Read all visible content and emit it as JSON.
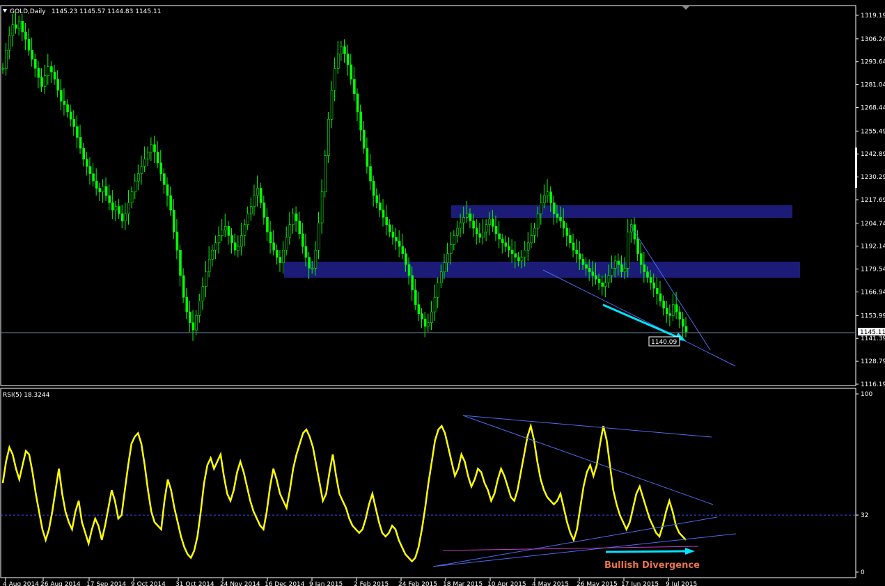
{
  "window": {
    "symbol_label": "GOLD,Daily",
    "ohlc_label": "1145.23 1145.57 1144.83 1145.11",
    "menu_icon": "triangle-down-icon"
  },
  "colors": {
    "background": "#000000",
    "candle": "#00ff00",
    "rsi_line": "#ffff00",
    "zone": "#1c1c78",
    "trendline": "#4c6cf0",
    "arrow": "#00e5ff",
    "magenta_line": "#c040c0",
    "annotation_text": "#e8734a",
    "bid_line": "#6a8aa0"
  },
  "chart_data": [
    {
      "type": "candlestick",
      "title": "GOLD,Daily",
      "ylim": [
        1116.19,
        1319.19
      ],
      "y_ticks": [
        "1319.19",
        "1306.24",
        "1293.64",
        "1281.04",
        "1268.44",
        "1255.49",
        "1242.89",
        "1230.29",
        "1217.69",
        "1204.74",
        "1192.14",
        "1179.54",
        "1166.94",
        "1153.99",
        "1141.39",
        "1128.79",
        "1116.19"
      ],
      "x_ticks": [
        "4 Aug 2014",
        "26 Aug 2014",
        "17 Sep 2014",
        "9 Oct 2014",
        "31 Oct 2014",
        "24 Nov 2014",
        "16 Dec 2014",
        "9 Jan 2015",
        "2 Feb 2015",
        "24 Feb 2015",
        "18 Mar 2015",
        "10 Apr 2015",
        "4 May 2015",
        "26 May 2015",
        "17 Jun 2015",
        "9 Jul 2015"
      ],
      "current_price_label": "1145.11",
      "current_price": 1145.11,
      "annotation_label": "1140.09",
      "closes": [
        1290,
        1300,
        1308,
        1314,
        1312,
        1316,
        1310,
        1306,
        1300,
        1295,
        1290,
        1285,
        1280,
        1286,
        1291,
        1288,
        1284,
        1278,
        1272,
        1270,
        1266,
        1262,
        1258,
        1252,
        1246,
        1240,
        1236,
        1232,
        1228,
        1224,
        1222,
        1225,
        1220,
        1216,
        1212,
        1214,
        1210,
        1206,
        1210,
        1216,
        1222,
        1228,
        1232,
        1236,
        1240,
        1244,
        1248,
        1244,
        1238,
        1232,
        1226,
        1220,
        1212,
        1200,
        1190,
        1176,
        1164,
        1156,
        1150,
        1146,
        1154,
        1162,
        1170,
        1178,
        1185,
        1190,
        1194,
        1198,
        1201,
        1203,
        1198,
        1194,
        1190,
        1192,
        1198,
        1204,
        1210,
        1214,
        1220,
        1224,
        1216,
        1208,
        1200,
        1194,
        1190,
        1186,
        1183,
        1190,
        1197,
        1204,
        1210,
        1206,
        1199,
        1192,
        1186,
        1180,
        1180,
        1190,
        1205,
        1222,
        1242,
        1262,
        1278,
        1290,
        1298,
        1302,
        1298,
        1292,
        1284,
        1276,
        1266,
        1256,
        1246,
        1236,
        1228,
        1220,
        1216,
        1212,
        1208,
        1204,
        1200,
        1197,
        1195,
        1192,
        1188,
        1182,
        1176,
        1168,
        1160,
        1155,
        1152,
        1148,
        1150,
        1156,
        1164,
        1172,
        1178,
        1183,
        1188,
        1193,
        1198,
        1202,
        1205,
        1208,
        1210,
        1206,
        1202,
        1199,
        1197,
        1200,
        1204,
        1207,
        1203,
        1199,
        1196,
        1194,
        1192,
        1190,
        1188,
        1186,
        1184,
        1186,
        1190,
        1194,
        1198,
        1202,
        1210,
        1216,
        1220,
        1222,
        1216,
        1210,
        1208,
        1206,
        1202,
        1198,
        1194,
        1190,
        1188,
        1185,
        1182,
        1180,
        1178,
        1176,
        1174,
        1172,
        1170,
        1172,
        1176,
        1180,
        1184,
        1182,
        1178,
        1180,
        1200,
        1204,
        1196,
        1188,
        1182,
        1178,
        1175,
        1172,
        1169,
        1166,
        1162,
        1158,
        1155,
        1154,
        1160,
        1156,
        1152,
        1148,
        1145
      ],
      "rsi_line": true
    },
    {
      "type": "line",
      "title": "RSI(5) 18.3244",
      "ylim": [
        0,
        100
      ],
      "y_ticks": [
        "100",
        "32",
        "0"
      ],
      "level": 32,
      "annotation": "Bullish Divergence",
      "values": [
        50,
        62,
        70,
        66,
        58,
        52,
        60,
        68,
        66,
        56,
        44,
        34,
        24,
        18,
        24,
        34,
        46,
        58,
        44,
        34,
        28,
        24,
        34,
        40,
        28,
        22,
        16,
        24,
        30,
        26,
        18,
        26,
        36,
        46,
        40,
        30,
        32,
        46,
        60,
        72,
        76,
        78,
        72,
        60,
        46,
        34,
        28,
        26,
        24,
        40,
        52,
        46,
        36,
        28,
        20,
        14,
        10,
        8,
        12,
        20,
        34,
        50,
        60,
        64,
        58,
        62,
        66,
        54,
        44,
        40,
        46,
        56,
        62,
        56,
        48,
        40,
        34,
        30,
        26,
        24,
        34,
        48,
        58,
        52,
        44,
        40,
        36,
        46,
        58,
        66,
        72,
        78,
        80,
        76,
        70,
        60,
        50,
        40,
        44,
        56,
        66,
        54,
        44,
        40,
        36,
        30,
        26,
        24,
        22,
        24,
        30,
        38,
        44,
        36,
        28,
        22,
        20,
        22,
        26,
        24,
        18,
        14,
        10,
        8,
        6,
        8,
        14,
        24,
        36,
        50,
        62,
        74,
        80,
        82,
        78,
        70,
        62,
        54,
        58,
        66,
        62,
        54,
        48,
        52,
        58,
        56,
        50,
        46,
        40,
        44,
        52,
        58,
        54,
        48,
        42,
        40,
        46,
        56,
        66,
        76,
        82,
        74,
        62,
        52,
        46,
        42,
        40,
        38,
        40,
        44,
        36,
        28,
        22,
        18,
        24,
        36,
        48,
        56,
        60,
        54,
        60,
        72,
        82,
        74,
        60,
        46,
        38,
        32,
        28,
        24,
        28,
        36,
        44,
        48,
        42,
        36,
        30,
        26,
        22,
        20,
        26,
        34,
        40,
        34,
        26,
        22,
        20,
        18
      ]
    }
  ]
}
